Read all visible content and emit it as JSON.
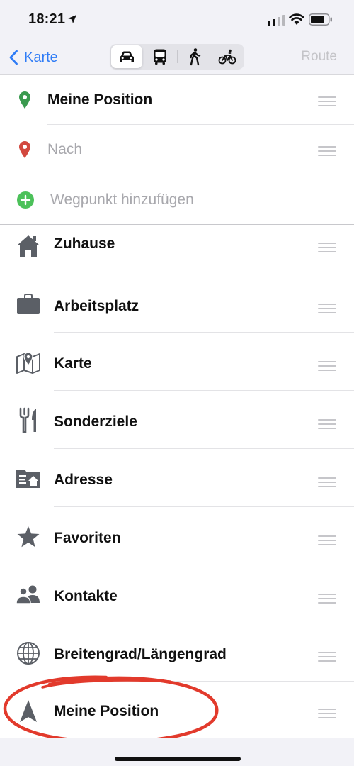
{
  "status_bar": {
    "time": "18:21"
  },
  "nav": {
    "back_label": "Karte",
    "route_label": "Route",
    "modes": [
      {
        "icon": "car-icon",
        "selected": true
      },
      {
        "icon": "bus-icon",
        "selected": false
      },
      {
        "icon": "walk-icon",
        "selected": false
      },
      {
        "icon": "bicycle-icon",
        "selected": false
      }
    ]
  },
  "route_fields": {
    "from": "Meine Position",
    "to_placeholder": "Nach",
    "add_waypoint": "Wegpunkt hinzufügen"
  },
  "items": [
    {
      "label": "Zuhause",
      "icon": "house-icon"
    },
    {
      "label": "Arbeitsplatz",
      "icon": "briefcase-icon"
    },
    {
      "label": "Karte",
      "icon": "map-icon"
    },
    {
      "label": "Sonderziele",
      "icon": "fork-knife-icon"
    },
    {
      "label": "Adresse",
      "icon": "address-card-icon"
    },
    {
      "label": "Favoriten",
      "icon": "star-icon"
    },
    {
      "label": "Kontakte",
      "icon": "contacts-icon"
    },
    {
      "label": "Breitengrad/Längengrad",
      "icon": "globe-icon"
    },
    {
      "label": "Meine Position",
      "icon": "location-arrow-icon"
    }
  ],
  "colors": {
    "accent": "#2f7cf6",
    "from_pin": "#3a9a4f",
    "to_pin": "#d2483f",
    "add_button": "#4cc15a",
    "annotation": "#e23a2c"
  }
}
